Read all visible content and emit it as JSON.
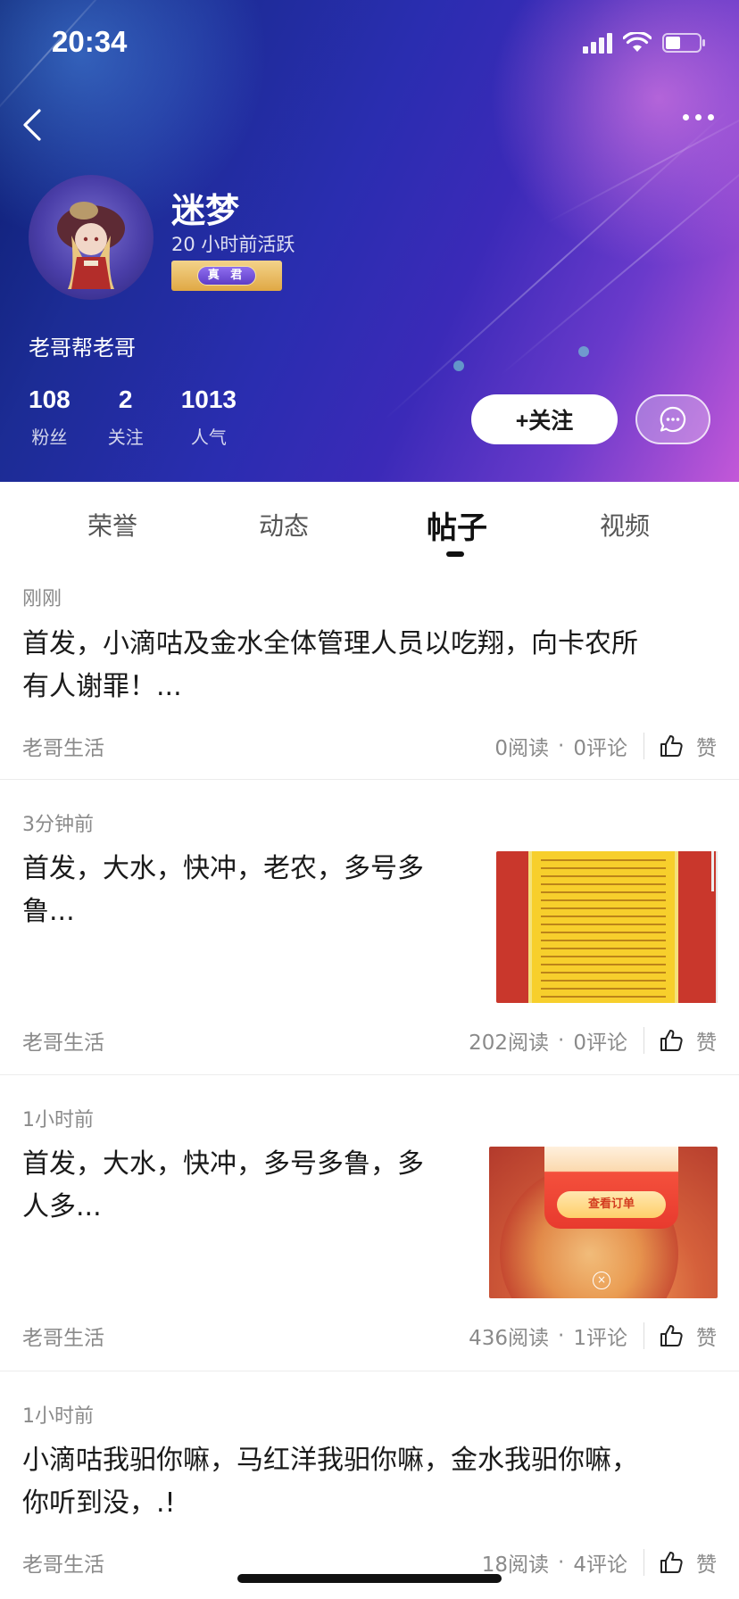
{
  "status_bar": {
    "time": "20:34"
  },
  "profile": {
    "username": "迷梦",
    "active_time": "20 小时前活跃",
    "badge_text": "真 君",
    "bio": "老哥帮老哥",
    "stats": [
      {
        "value": "108",
        "label": "粉丝"
      },
      {
        "value": "2",
        "label": "关注"
      },
      {
        "value": "1013",
        "label": "人气"
      }
    ],
    "follow_label": "+关注"
  },
  "tabs": [
    {
      "label": "荣誉",
      "active": false
    },
    {
      "label": "动态",
      "active": false
    },
    {
      "label": "帖子",
      "active": true
    },
    {
      "label": "视频",
      "active": false
    }
  ],
  "posts": [
    {
      "time": "刚刚",
      "title_line1": "首发，小滴咕及金水全体管理人员以吃翔，向卡农所",
      "title_line2": "有人谢罪！...",
      "source": "老哥生活",
      "reads": "0阅读",
      "comments": "0评论",
      "like_label": "赞"
    },
    {
      "time": "3分钟前",
      "title_line1": "首发，大水，快冲，老农，多号多",
      "title_line2": "鲁...",
      "source": "老哥生活",
      "reads": "202阅读",
      "comments": "0评论",
      "like_label": "赞"
    },
    {
      "time": "1小时前",
      "title_line1": "首发，大水，快冲，多号多鲁，多",
      "title_line2": "人多...",
      "source": "老哥生活",
      "reads": "436阅读",
      "comments": "1评论",
      "like_label": "赞",
      "thumb_button": "查看订单"
    },
    {
      "time": "1小时前",
      "title_line1": "小滴咕我驲你嘛，马红洋我驲你嘛，金水我驲你嘛，",
      "title_line2": "你听到没，.!",
      "source": "老哥生活",
      "reads": "18阅读",
      "comments": "4评论",
      "like_label": "赞"
    }
  ],
  "counts_separator": "·"
}
